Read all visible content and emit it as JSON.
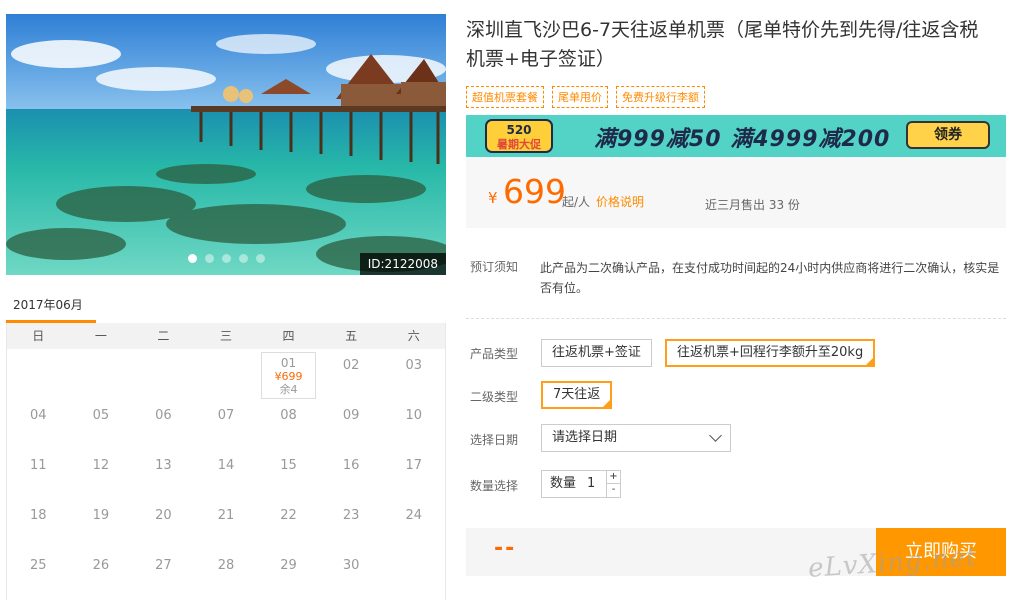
{
  "hero": {
    "id_badge": "ID:2122008",
    "slide_count": 5,
    "active_slide": 1
  },
  "calendar": {
    "month_label": "2017年06月",
    "weekdays": [
      "日",
      "一",
      "二",
      "三",
      "四",
      "五",
      "六"
    ],
    "rows": [
      [
        "",
        "",
        "",
        "",
        "01",
        "02",
        "03"
      ],
      [
        "04",
        "05",
        "06",
        "07",
        "08",
        "09",
        "10"
      ],
      [
        "11",
        "12",
        "13",
        "14",
        "15",
        "16",
        "17"
      ],
      [
        "18",
        "19",
        "20",
        "21",
        "22",
        "23",
        "24"
      ],
      [
        "25",
        "26",
        "27",
        "28",
        "29",
        "30",
        ""
      ]
    ],
    "available": {
      "day": "01",
      "price": "¥699",
      "remaining": "余4"
    }
  },
  "product": {
    "title": "深圳直飞沙巴6-7天往返单机票（尾单特价先到先得/往返含税机票+电子签证）",
    "tags": [
      "超值机票套餐",
      "尾单甩价",
      "免费升级行李额"
    ]
  },
  "banner": {
    "badge_top": "520",
    "badge_bottom": "暑期大促",
    "offer": "满999减50 满4999减200",
    "button": "领券"
  },
  "price": {
    "currency": "¥",
    "amount": "699",
    "unit": "起/人",
    "explain_link": "价格说明",
    "sold": "近三月售出 33 份"
  },
  "notice": {
    "label": "预订须知",
    "text": "此产品为二次确认产品，在支付成功时间起的24小时内供应商将进行二次确认，核实是否有位。"
  },
  "options": {
    "product_type": {
      "label": "产品类型",
      "choices": [
        "往返机票+签证",
        "往返机票+回程行李额升至20kg"
      ],
      "selected_index": 1
    },
    "sub_type": {
      "label": "二级类型",
      "choices": [
        "7天往返"
      ],
      "selected_index": 0
    },
    "date": {
      "label": "选择日期",
      "value": "请选择日期"
    },
    "quantity": {
      "label": "数量选择",
      "inner_label": "数量",
      "value": "1",
      "plus": "+",
      "minus": "-"
    }
  },
  "buy": {
    "total": "--",
    "button": "立即购买"
  },
  "watermark": "eLvXing.net",
  "colors": {
    "accent": "#ff9800",
    "price": "#ff6a00",
    "banner": "#53d3c6"
  }
}
